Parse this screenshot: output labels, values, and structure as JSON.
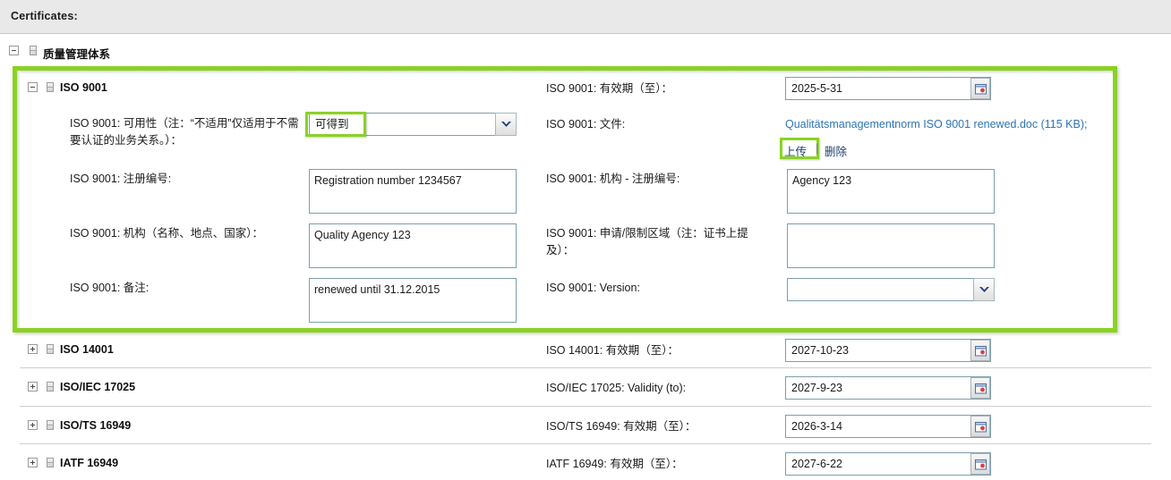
{
  "header": {
    "title": "Certificates:"
  },
  "tree": {
    "root": {
      "label": "质量管理体系",
      "expander": "minus",
      "icon": "document-icon"
    }
  },
  "iso9001": {
    "node_label": "ISO 9001",
    "expander": "minus",
    "fields": {
      "availability_label": "ISO 9001: 可用性（注：“不适用”仅适用于不需要认证的业务关系。）：",
      "availability_value": "可得到",
      "registration_label": "ISO 9001: 注册编号:",
      "registration_value": "Registration number 1234567",
      "agency_label": "ISO 9001: 机构（名称、地点、国家）：",
      "agency_value": "Quality Agency 123",
      "remarks_label": "ISO 9001: 备注:",
      "remarks_value": "renewed until 31.12.2015",
      "validity_label": "ISO 9001: 有效期（至）：",
      "validity_value": "2025-5-31",
      "documents_label": "ISO 9001: 文件:",
      "document_link": "Qualitätsmanagementnorm ISO 9001 renewed.doc (115 KB);",
      "upload_label": "上传",
      "action_separator": "|",
      "delete_label": "删除",
      "agency_regnum_label": "ISO 9001: 机构 - 注册编号:",
      "agency_regnum_value": "Agency 123",
      "scope_label": "ISO 9001: 申请/限制区域（注：证书上提及）：",
      "scope_value": "",
      "version_label": "ISO 9001: Version:",
      "version_value": ""
    }
  },
  "other_certificates": [
    {
      "node_label": "ISO 14001",
      "expander": "plus",
      "field_label": "ISO 14001: 有效期（至）：",
      "date_value": "2027-10-23"
    },
    {
      "node_label": "ISO/IEC 17025",
      "expander": "plus",
      "field_label": "ISO/IEC 17025: Validity (to):",
      "date_value": "2027-9-23"
    },
    {
      "node_label": "ISO/TS 16949",
      "expander": "plus",
      "field_label": "ISO/TS 16949: 有效期（至）：",
      "date_value": "2026-3-14"
    },
    {
      "node_label": "IATF 16949",
      "expander": "plus",
      "field_label": "IATF 16949: 有效期（至）：",
      "date_value": "2027-6-22"
    }
  ],
  "colors": {
    "highlight_green": "#8ad223",
    "header_bg": "#e9e9e9",
    "input_border": "#7d9fad",
    "link_blue": "#2e74b5",
    "action_blue": "#1f3f6e"
  },
  "icons": {
    "expander_minus": "minus-box-icon",
    "expander_plus": "plus-box-icon",
    "node": "document-icon",
    "calendar": "calendar-icon",
    "dropdown": "chevron-down-icon"
  }
}
